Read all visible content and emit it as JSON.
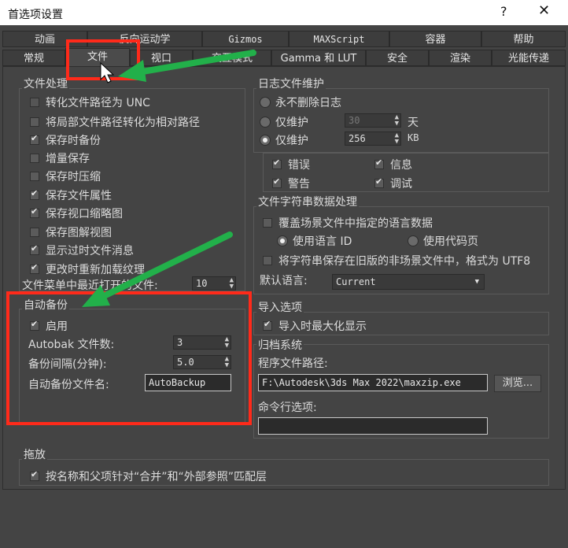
{
  "window": {
    "title": "首选项设置",
    "help": "?",
    "close": "✕"
  },
  "tabs_top": [
    "动画",
    "反向运动学",
    "Gizmos",
    "MAXScript",
    "容器",
    "帮助"
  ],
  "tabs_bottom": [
    "常规",
    "文件",
    "视口",
    "交互模式",
    "Gamma 和 LUT",
    "安全",
    "渲染",
    "光能传递"
  ],
  "file_handling": {
    "title": "文件处理",
    "items": [
      {
        "label": "转化文件路径为 UNC",
        "checked": false
      },
      {
        "label": "将局部文件路径转化为相对路径",
        "checked": false
      },
      {
        "label": "保存时备份",
        "checked": true
      },
      {
        "label": "增量保存",
        "checked": false
      },
      {
        "label": "保存时压缩",
        "checked": false
      },
      {
        "label": "保存文件属性",
        "checked": true
      },
      {
        "label": "保存视口缩略图",
        "checked": true
      },
      {
        "label": "保存图解视图",
        "checked": false
      },
      {
        "label": "显示过时文件消息",
        "checked": true
      },
      {
        "label": "更改时重新加载纹理",
        "checked": true
      }
    ],
    "recent_files_label": "文件菜单中最近打开的文件:",
    "recent_files_value": "10"
  },
  "auto_backup": {
    "title": "自动备份",
    "enable_label": "启用",
    "enabled": true,
    "count_label": "Autobak 文件数:",
    "count_value": "3",
    "interval_label": "备份间隔(分钟):",
    "interval_value": "5.0",
    "filename_label": "自动备份文件名:",
    "filename_value": "AutoBackup"
  },
  "log_maintenance": {
    "title": "日志文件维护",
    "never_delete": "永不删除日志",
    "keep_days_label": "仅维护",
    "keep_days_value": "30",
    "days_unit": "天",
    "keep_kb_label": "仅维护",
    "keep_kb_value": "256",
    "kb_unit": "KB",
    "selected": "kb",
    "levels": [
      {
        "label": "错误",
        "checked": true
      },
      {
        "label": "信息",
        "checked": true
      },
      {
        "label": "警告",
        "checked": true
      },
      {
        "label": "调试",
        "checked": true
      }
    ]
  },
  "string_handling": {
    "title": "文件字符串数据处理",
    "override_label": "覆盖场景文件中指定的语言数据",
    "use_lang_id": "使用语言 ID",
    "use_codepage": "使用代码页",
    "save_utf8": "将字符串保存在旧版的非场景文件中，格式为 UTF8",
    "default_lang_label": "默认语言:",
    "default_lang_value": "Current"
  },
  "import_options": {
    "title": "导入选项",
    "maximize_label": "导入时最大化显示",
    "maximize": true
  },
  "archive": {
    "title": "归档系统",
    "program_path_label": "程序文件路径:",
    "program_path_value": "F:\\Autodesk\\3ds Max 2022\\maxzip.exe",
    "browse_label": "浏览...",
    "cmdline_label": "命令行选项:",
    "cmdline_value": ""
  },
  "drag_drop": {
    "title": "拖放",
    "match_label": "按名称和父项针对“合并”和“外部参照”匹配层",
    "checked": true
  },
  "annotation_colors": {
    "red": "#ff2a1a",
    "green": "#22b04a"
  }
}
